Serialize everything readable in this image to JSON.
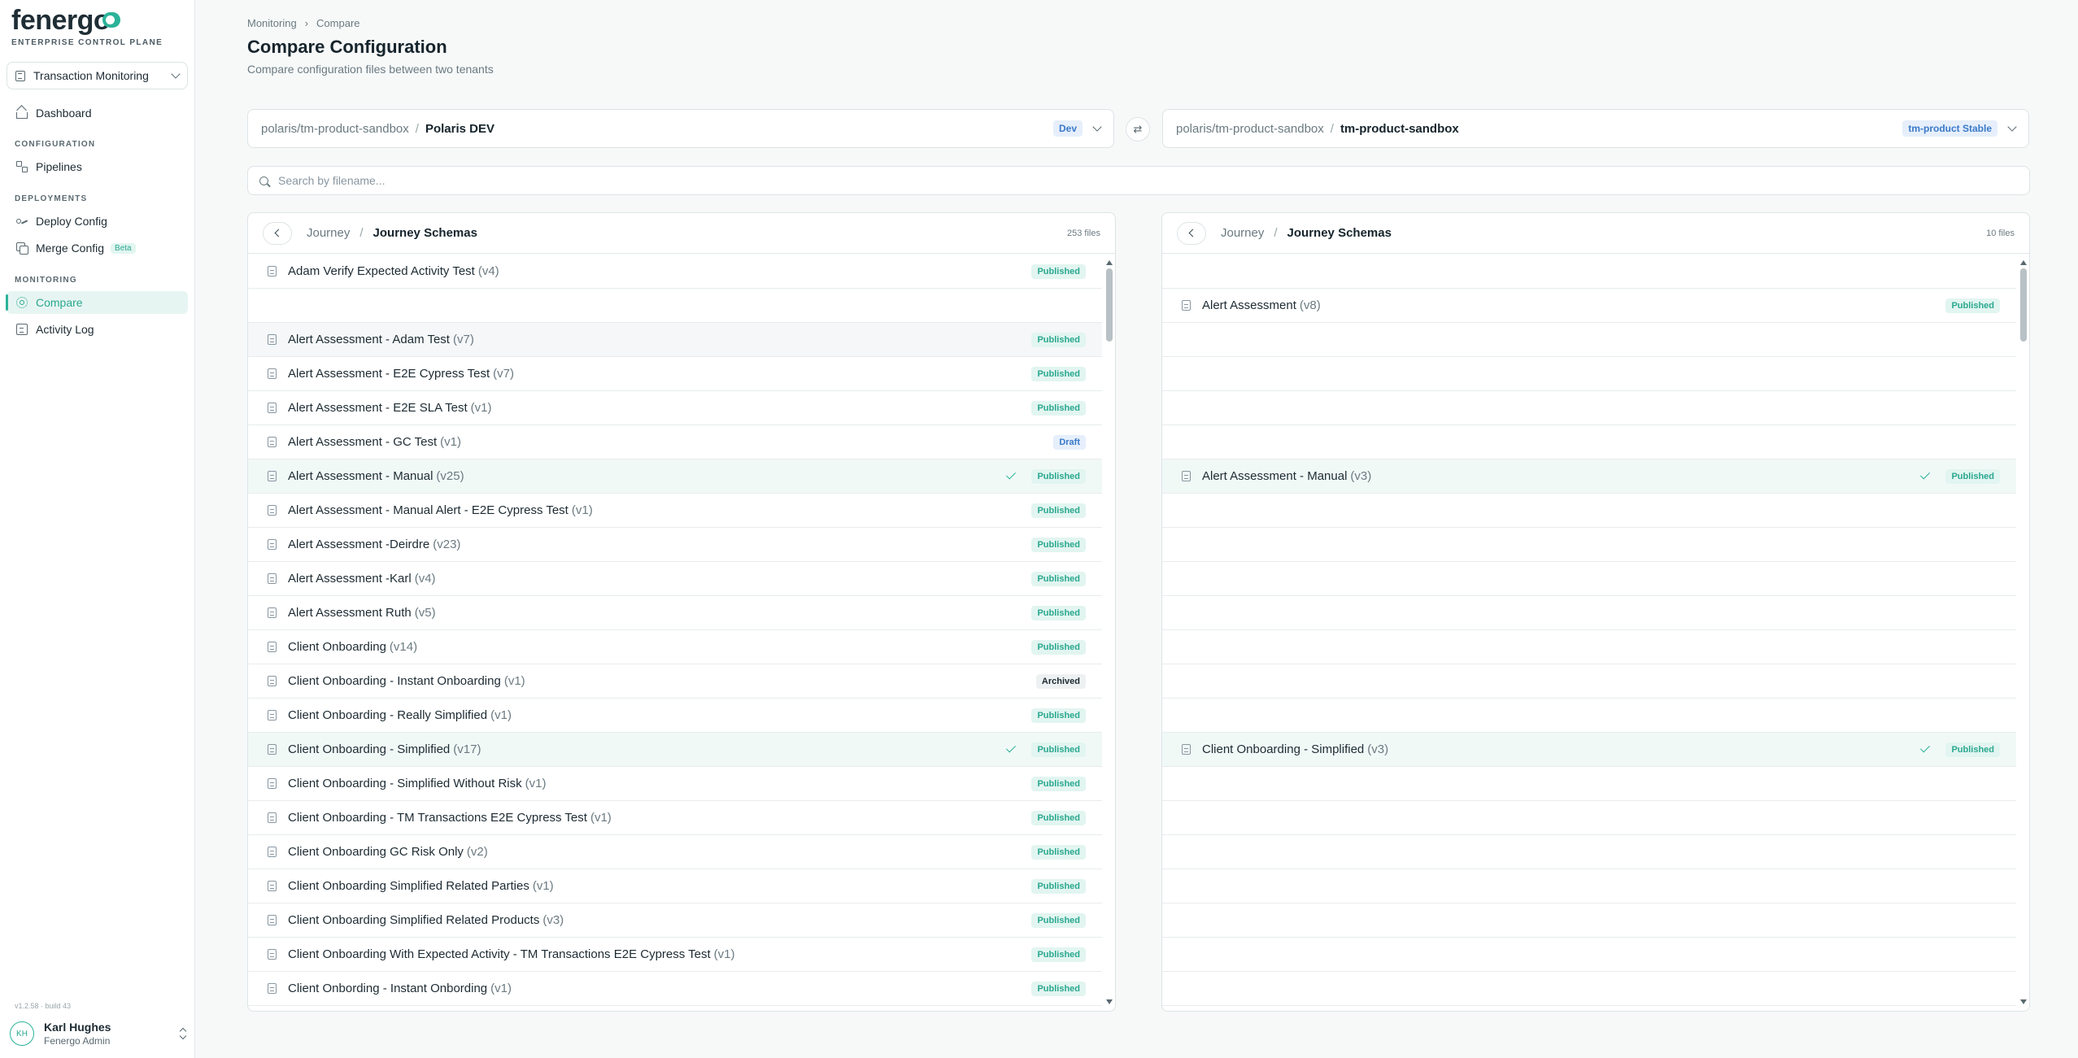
{
  "brand": {
    "logo": "fenergo",
    "subtitle": "ENTERPRISE CONTROL PLANE",
    "accent": "#2bb39a"
  },
  "sidebar": {
    "tenant_selector": "Transaction Monitoring",
    "dashboard": "Dashboard",
    "sections": {
      "configuration": "CONFIGURATION",
      "deployments": "DEPLOYMENTS",
      "monitoring": "MONITORING"
    },
    "pipelines": "Pipelines",
    "deploy_config": "Deploy Config",
    "merge_config": "Merge Config",
    "merge_badge": "Beta",
    "compare": "Compare",
    "activity_log": "Activity Log",
    "version": "v1.2.58 · build 43",
    "user": {
      "initials": "KH",
      "name": "Karl Hughes",
      "role": "Fenergo Admin"
    }
  },
  "header": {
    "breadcrumb": [
      "Monitoring",
      "Compare"
    ],
    "title": "Compare Configuration",
    "subtitle": "Compare configuration files between two tenants"
  },
  "left_tenant": {
    "path": "polaris/tm-product-sandbox",
    "name": "Polaris DEV",
    "badge": "Dev"
  },
  "right_tenant": {
    "path": "polaris/tm-product-sandbox",
    "name": "tm-product-sandbox",
    "badge": "tm-product Stable"
  },
  "search": {
    "placeholder": "Search by filename..."
  },
  "left_panel": {
    "root": "Journey",
    "folder": "Journey Schemas",
    "count": "253 files",
    "rows": [
      {
        "name": "Adam Verify Expected Activity Test",
        "ver": "(v4)",
        "status": "Published"
      },
      {
        "name": "",
        "ver": "",
        "status": ""
      },
      {
        "name": "Alert Assessment - Adam Test",
        "ver": "(v7)",
        "status": "Published",
        "hover": true
      },
      {
        "name": "Alert Assessment - E2E Cypress Test",
        "ver": "(v7)",
        "status": "Published"
      },
      {
        "name": "Alert Assessment - E2E SLA Test",
        "ver": "(v1)",
        "status": "Published"
      },
      {
        "name": "Alert Assessment - GC Test",
        "ver": "(v1)",
        "status": "Draft"
      },
      {
        "name": "Alert Assessment - Manual",
        "ver": "(v25)",
        "status": "Published",
        "match": true
      },
      {
        "name": "Alert Assessment - Manual Alert - E2E Cypress Test",
        "ver": "(v1)",
        "status": "Published"
      },
      {
        "name": "Alert Assessment -Deirdre",
        "ver": "(v23)",
        "status": "Published"
      },
      {
        "name": "Alert Assessment -Karl",
        "ver": "(v4)",
        "status": "Published"
      },
      {
        "name": "Alert Assessment Ruth",
        "ver": "(v5)",
        "status": "Published"
      },
      {
        "name": "Client Onboarding",
        "ver": "(v14)",
        "status": "Published"
      },
      {
        "name": "Client Onboarding - Instant Onboarding",
        "ver": "(v1)",
        "status": "Archived"
      },
      {
        "name": "Client Onboarding - Really Simplified",
        "ver": "(v1)",
        "status": "Published"
      },
      {
        "name": "Client Onboarding - Simplified",
        "ver": "(v17)",
        "status": "Published",
        "match": true
      },
      {
        "name": "Client Onboarding - Simplified Without Risk",
        "ver": "(v1)",
        "status": "Published"
      },
      {
        "name": "Client Onboarding - TM Transactions E2E Cypress Test",
        "ver": "(v1)",
        "status": "Published"
      },
      {
        "name": "Client Onboarding GC Risk Only",
        "ver": "(v2)",
        "status": "Published"
      },
      {
        "name": "Client Onboarding Simplified Related Parties",
        "ver": "(v1)",
        "status": "Published"
      },
      {
        "name": "Client Onboarding Simplified Related Products",
        "ver": "(v3)",
        "status": "Published"
      },
      {
        "name": "Client Onboarding With Expected Activity - TM Transactions E2E Cypress Test",
        "ver": "(v1)",
        "status": "Published"
      },
      {
        "name": "Client Onbording - Instant Onbording",
        "ver": "(v1)",
        "status": "Published"
      }
    ]
  },
  "right_panel": {
    "root": "Journey",
    "folder": "Journey Schemas",
    "count": "10 files",
    "rows": [
      {
        "name": "",
        "ver": "",
        "status": ""
      },
      {
        "name": "Alert Assessment",
        "ver": "(v8)",
        "status": "Published"
      },
      {
        "name": "",
        "ver": "",
        "status": ""
      },
      {
        "name": "",
        "ver": "",
        "status": ""
      },
      {
        "name": "",
        "ver": "",
        "status": ""
      },
      {
        "name": "",
        "ver": "",
        "status": ""
      },
      {
        "name": "Alert Assessment - Manual",
        "ver": "(v3)",
        "status": "Published",
        "match": true
      },
      {
        "name": "",
        "ver": "",
        "status": ""
      },
      {
        "name": "",
        "ver": "",
        "status": ""
      },
      {
        "name": "",
        "ver": "",
        "status": ""
      },
      {
        "name": "",
        "ver": "",
        "status": ""
      },
      {
        "name": "",
        "ver": "",
        "status": ""
      },
      {
        "name": "",
        "ver": "",
        "status": ""
      },
      {
        "name": "",
        "ver": "",
        "status": ""
      },
      {
        "name": "Client Onboarding - Simplified",
        "ver": "(v3)",
        "status": "Published",
        "match": true
      },
      {
        "name": "",
        "ver": "",
        "status": ""
      },
      {
        "name": "",
        "ver": "",
        "status": ""
      },
      {
        "name": "",
        "ver": "",
        "status": ""
      },
      {
        "name": "",
        "ver": "",
        "status": ""
      },
      {
        "name": "",
        "ver": "",
        "status": ""
      },
      {
        "name": "",
        "ver": "",
        "status": ""
      },
      {
        "name": "",
        "ver": "",
        "status": ""
      }
    ]
  }
}
